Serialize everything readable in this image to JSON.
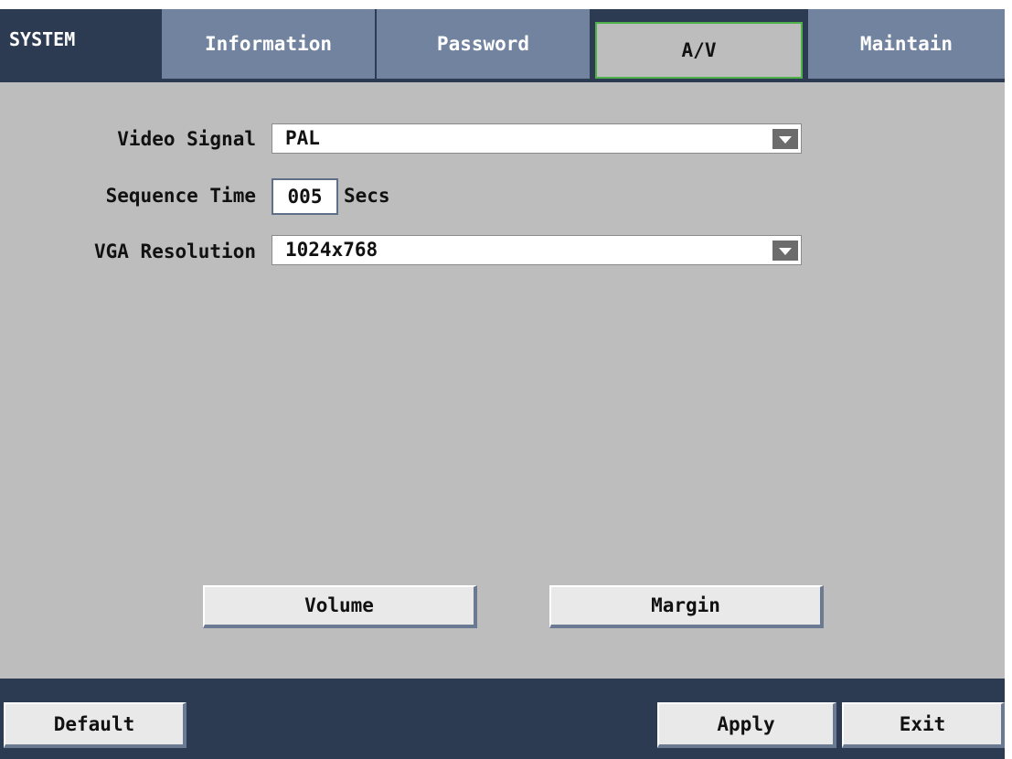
{
  "header": {
    "title": "SYSTEM",
    "tabs": [
      {
        "label": "Information"
      },
      {
        "label": "Password"
      },
      {
        "label": "A/V",
        "active": true
      },
      {
        "label": "Maintain"
      }
    ]
  },
  "form": {
    "video_signal": {
      "label": "Video Signal",
      "value": "PAL"
    },
    "sequence_time": {
      "label": "Sequence Time",
      "value": "005",
      "unit": "Secs"
    },
    "vga_resolution": {
      "label": "VGA Resolution",
      "value": "1024x768"
    }
  },
  "buttons": {
    "volume": "Volume",
    "margin": "Margin"
  },
  "footer": {
    "default": "Default",
    "apply": "Apply",
    "exit": "Exit"
  },
  "colors": {
    "bar_bg": "#2c3a52",
    "tab_bg": "#72839f",
    "panel_bg": "#bdbdbd",
    "active_tab_border": "#4fb14a"
  }
}
